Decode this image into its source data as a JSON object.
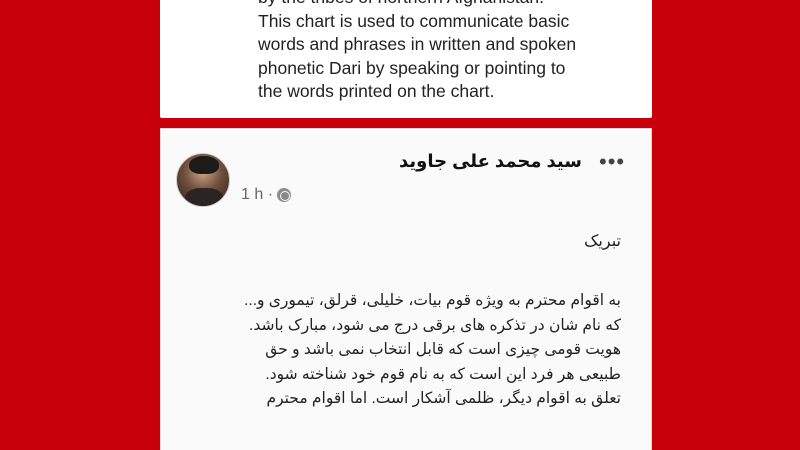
{
  "top_post": {
    "lines": [
      "by the tribes of northern Afghanistan.",
      "This chart is used to communicate basic",
      "words and phrases in written and spoken",
      "phonetic Dari by speaking or pointing to",
      "the words printed on the chart."
    ]
  },
  "post": {
    "author": "سید محمد علی جاوید",
    "time": "1 h ·",
    "more_icon": "•••",
    "title": "تبریک",
    "lines": [
      "به اقوام محترم به ویژه قوم بیات، خلیلی، قرلق، تیموری و...",
      "که نام شان در تذکره های برقی درج می شود، مبارک باشد.",
      "هویت قومی چیزی است که قابل انتخاب نمی باشد و حق",
      "طبیعی هر فرد این است که به نام قوم خود شناخته شود.",
      "تعلق به اقوام دیگر، ظلمی آشکار است. اما اقوام محترم"
    ]
  }
}
